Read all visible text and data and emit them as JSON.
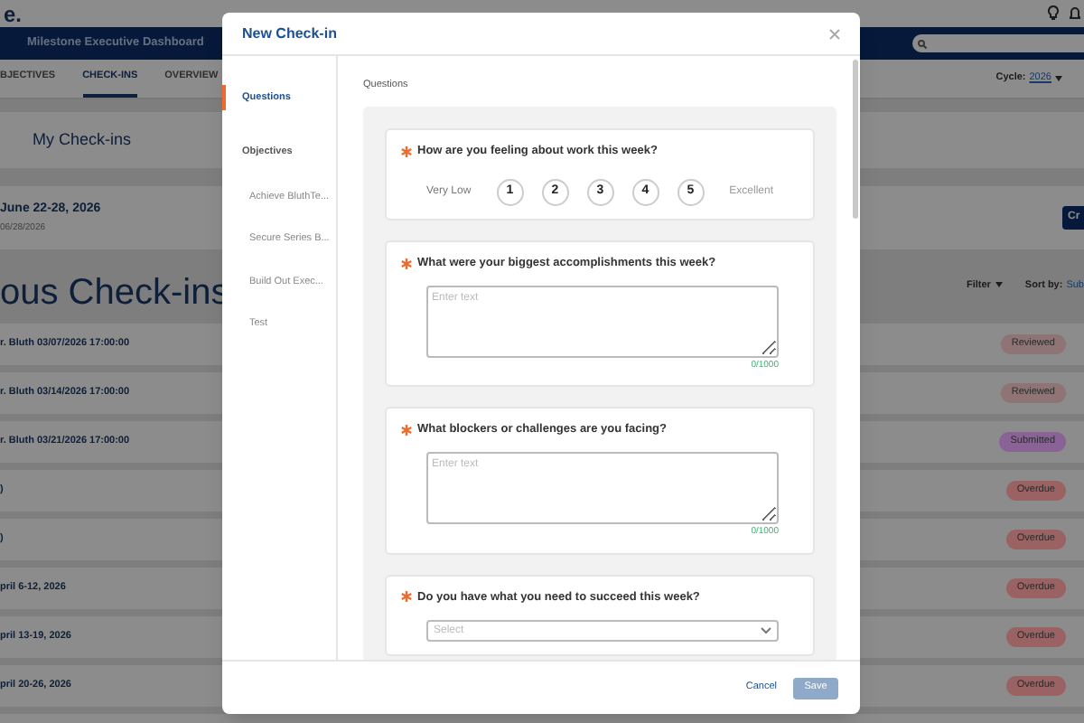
{
  "app": {
    "logo": "e.",
    "banner": "Milestone Executive Dashboard"
  },
  "tabs": [
    {
      "label": "BJECTIVES",
      "selected": false
    },
    {
      "label": "CHECK-INS",
      "selected": true
    },
    {
      "label": "OVERVIEW",
      "selected": false
    }
  ],
  "cycle": {
    "label": "Cycle:",
    "value": "2026"
  },
  "my_checkins": {
    "title": "My Check-ins"
  },
  "current": {
    "title": "June 22-28, 2026",
    "date": "06/28/2026",
    "button": "Cr"
  },
  "previous": {
    "title": "ous Check-ins",
    "filter": "Filter",
    "sort_label": "Sort by:",
    "sort_value": "Sub",
    "rows": [
      {
        "title": "r. Bluth 03/07/2026 17:00:00",
        "status": "Reviewed",
        "color": "#8e7474"
      },
      {
        "title": "r. Bluth 03/14/2026 17:00:00",
        "status": "Reviewed",
        "color": "#8e7474"
      },
      {
        "title": "r. Bluth 03/21/2026 17:00:00",
        "status": "Submitted",
        "color": "#8a6396"
      },
      {
        "title": ")",
        "status": "Overdue",
        "color": "#9a6262"
      },
      {
        "title": ")",
        "status": "Overdue",
        "color": "#9a6262"
      },
      {
        "title": "pril 6-12, 2026",
        "status": "Overdue",
        "color": "#9a6262"
      },
      {
        "title": "pril 13-19, 2026",
        "status": "Overdue",
        "color": "#9a6262"
      },
      {
        "title": "pril 20-26, 2026",
        "status": "Overdue",
        "color": "#9a6262"
      }
    ]
  },
  "dialog": {
    "title": "New Check-in",
    "nav": [
      {
        "label": "Questions",
        "selected": true
      },
      {
        "label": "Objectives",
        "selected": false,
        "children": [
          {
            "label": "Achieve BluthTe...",
            "selected": false
          },
          {
            "label": "Secure Series B...",
            "selected": false
          },
          {
            "label": "Build Out Exec...",
            "selected": false
          },
          {
            "label": "Test",
            "selected": false
          }
        ]
      }
    ],
    "section": "Questions",
    "questions": [
      {
        "kind": "rating",
        "text": "How are you feeling about work this week?",
        "required": true,
        "low": "Very Low",
        "high": "Excellent",
        "options": [
          {
            "label": "1",
            "selected": false
          },
          {
            "label": "2",
            "selected": false
          },
          {
            "label": "3",
            "selected": false
          },
          {
            "label": "4",
            "selected": false
          },
          {
            "label": "5",
            "selected": false
          }
        ]
      },
      {
        "kind": "text",
        "text": "What were your biggest accomplishments this week?",
        "required": true,
        "placeholder": "Enter text",
        "counter": "0/1000"
      },
      {
        "kind": "text",
        "text": "What blockers or challenges are you facing?",
        "required": true,
        "placeholder": "Enter text",
        "counter": "0/1000"
      },
      {
        "kind": "select",
        "text": "Do you have what you need to succeed this week?",
        "required": true,
        "placeholder": "Select"
      }
    ],
    "cancel": "Cancel",
    "save": {
      "label": "Save",
      "disabled": true
    }
  }
}
